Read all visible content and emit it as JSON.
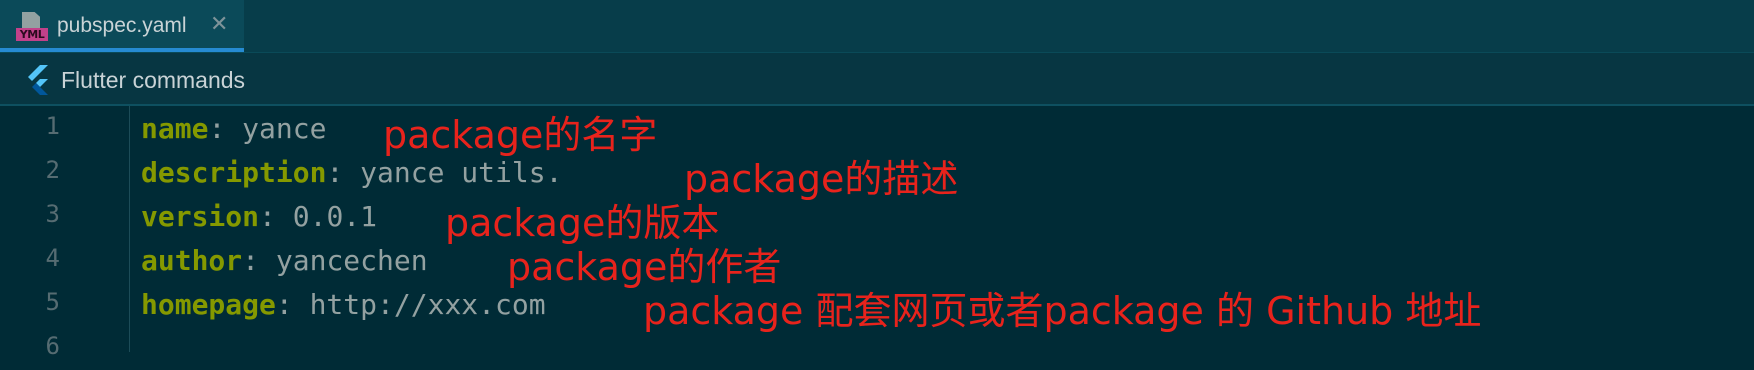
{
  "tab": {
    "icon": "yaml-file-icon",
    "icon_text": "YML",
    "label": "pubspec.yaml",
    "close": "✕"
  },
  "toolbar": {
    "icon": "flutter-icon",
    "label": "Flutter commands"
  },
  "lines": [
    {
      "num": "1",
      "key": "name",
      "sep": ": ",
      "value": "yance",
      "note": "package的名字"
    },
    {
      "num": "2",
      "key": "description",
      "sep": ": ",
      "value": "yance utils.",
      "note": "package的描述"
    },
    {
      "num": "3",
      "key": "version",
      "sep": ": ",
      "value": "0.0.1",
      "note": "package的版本"
    },
    {
      "num": "4",
      "key": "author",
      "sep": ": ",
      "value": "yancechen",
      "note": "package的作者"
    },
    {
      "num": "5",
      "key": "homepage",
      "sep": ": ",
      "value": "http://xxx.com",
      "note": "package 配套网页或者package 的 Github 地址"
    },
    {
      "num": "6",
      "key": "",
      "sep": "",
      "value": "",
      "note": ""
    }
  ],
  "colors": {
    "background": "#002b36",
    "key": "#859900",
    "value": "#93a1a1",
    "annotation": "#e8231c",
    "tab_accent": "#268bd2"
  }
}
